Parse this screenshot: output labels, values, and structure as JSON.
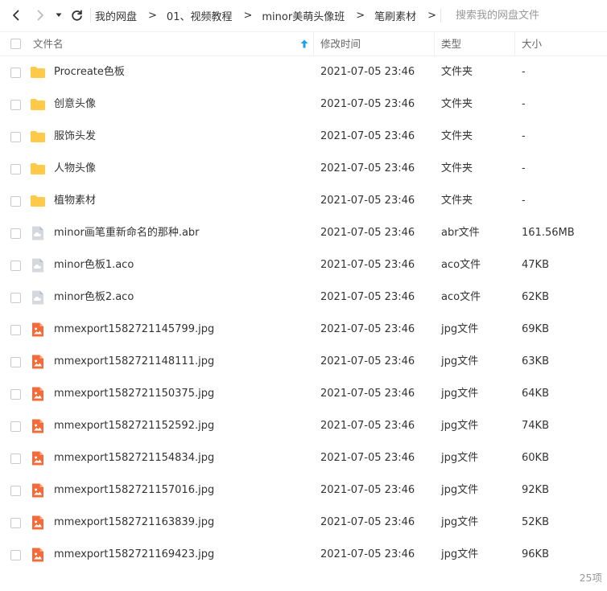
{
  "toolbar": {
    "breadcrumb": [
      "我的网盘",
      "01、视频教程",
      "minor美萌头像班",
      "笔刷素材"
    ],
    "separator": ">",
    "search_placeholder": "搜索我的网盘文件"
  },
  "header": {
    "name": "文件名",
    "modified": "修改时间",
    "type": "类型",
    "size": "大小"
  },
  "colors": {
    "folder": "#FFC94A",
    "generic_file": "#D5D8DE",
    "image_file": "#F26B3A",
    "sort_arrow": "#1E9EF5"
  },
  "files": [
    {
      "name": "Procreate色板",
      "modified": "2021-07-05 23:46",
      "type": "文件夹",
      "size": "-",
      "icon": "folder-icon"
    },
    {
      "name": "创意头像",
      "modified": "2021-07-05 23:46",
      "type": "文件夹",
      "size": "-",
      "icon": "folder-icon"
    },
    {
      "name": "服饰头发",
      "modified": "2021-07-05 23:46",
      "type": "文件夹",
      "size": "-",
      "icon": "folder-icon"
    },
    {
      "name": "人物头像",
      "modified": "2021-07-05 23:46",
      "type": "文件夹",
      "size": "-",
      "icon": "folder-icon"
    },
    {
      "name": "植物素材",
      "modified": "2021-07-05 23:46",
      "type": "文件夹",
      "size": "-",
      "icon": "folder-icon"
    },
    {
      "name": "minor画笔重新命名的那种.abr",
      "modified": "2021-07-05 23:46",
      "type": "abr文件",
      "size": "161.56MB",
      "icon": "cloud-file-icon"
    },
    {
      "name": "minor色板1.aco",
      "modified": "2021-07-05 23:46",
      "type": "aco文件",
      "size": "47KB",
      "icon": "cloud-file-icon"
    },
    {
      "name": "minor色板2.aco",
      "modified": "2021-07-05 23:46",
      "type": "aco文件",
      "size": "62KB",
      "icon": "cloud-file-icon"
    },
    {
      "name": "mmexport1582721145799.jpg",
      "modified": "2021-07-05 23:46",
      "type": "jpg文件",
      "size": "69KB",
      "icon": "image-file-icon"
    },
    {
      "name": "mmexport1582721148111.jpg",
      "modified": "2021-07-05 23:46",
      "type": "jpg文件",
      "size": "63KB",
      "icon": "image-file-icon"
    },
    {
      "name": "mmexport1582721150375.jpg",
      "modified": "2021-07-05 23:46",
      "type": "jpg文件",
      "size": "64KB",
      "icon": "image-file-icon"
    },
    {
      "name": "mmexport1582721152592.jpg",
      "modified": "2021-07-05 23:46",
      "type": "jpg文件",
      "size": "74KB",
      "icon": "image-file-icon"
    },
    {
      "name": "mmexport1582721154834.jpg",
      "modified": "2021-07-05 23:46",
      "type": "jpg文件",
      "size": "60KB",
      "icon": "image-file-icon"
    },
    {
      "name": "mmexport1582721157016.jpg",
      "modified": "2021-07-05 23:46",
      "type": "jpg文件",
      "size": "92KB",
      "icon": "image-file-icon"
    },
    {
      "name": "mmexport1582721163839.jpg",
      "modified": "2021-07-05 23:46",
      "type": "jpg文件",
      "size": "52KB",
      "icon": "image-file-icon"
    },
    {
      "name": "mmexport1582721169423.jpg",
      "modified": "2021-07-05 23:46",
      "type": "jpg文件",
      "size": "96KB",
      "icon": "image-file-icon"
    }
  ],
  "footer": {
    "count": "25项"
  }
}
